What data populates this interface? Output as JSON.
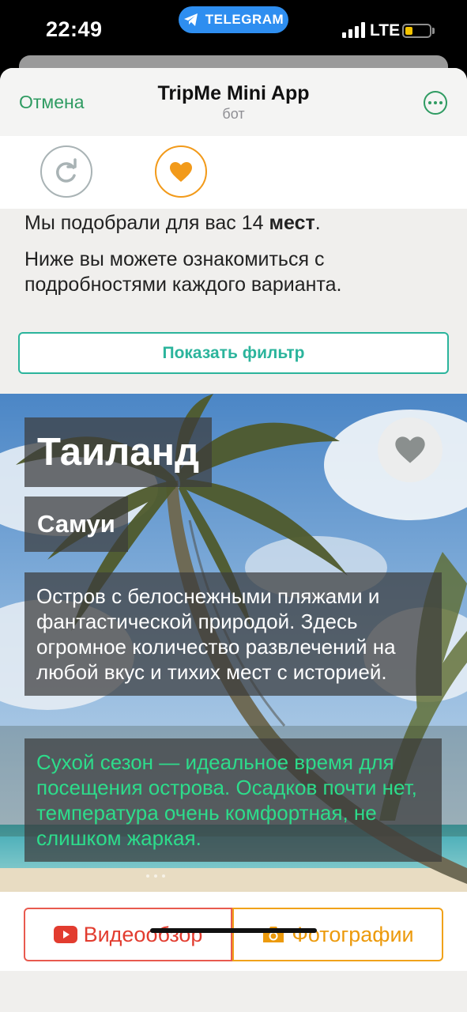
{
  "status_bar": {
    "time": "22:49",
    "pill_label": "TELEGRAM",
    "network": "LTE"
  },
  "nav": {
    "cancel": "Отмена",
    "title": "TripMe Mini App",
    "subtitle": "бот"
  },
  "intro": {
    "line1_prefix": "Мы подобрали для вас 14 ",
    "line1_bold": "мест",
    "line1_suffix": ".",
    "line2": "Ниже вы можете ознакомиться с подробностями каждого варианта."
  },
  "filter_button": "Показать фильтр",
  "destination": {
    "country": "Таиланд",
    "city": "Самуи",
    "description": "Остров с белоснежными пляжами и фантастической природой. Здесь огромное количество развлечений на любой вкус и тихих мест с историей.",
    "season": "Сухой сезон — идеальное время для посещения острова. Осадков почти нет, температура очень комфортная, не слишком жаркая."
  },
  "buttons": {
    "video": "Видеообзор",
    "photos": "Фотографии"
  },
  "colors": {
    "accent_green": "#2f9b62",
    "filter_teal": "#2bb49c",
    "season_green": "#2ddc8b",
    "video_red": "#e23c2f",
    "photo_orange": "#ec9a0c",
    "heart_orange": "#f29a1a"
  },
  "icons": {
    "pill": "telegram-plane-icon",
    "refresh": "refresh-icon",
    "heart": "heart-icon",
    "favorite": "heart-icon",
    "video": "youtube-icon",
    "photos": "camera-icon",
    "more": "more-icon"
  }
}
